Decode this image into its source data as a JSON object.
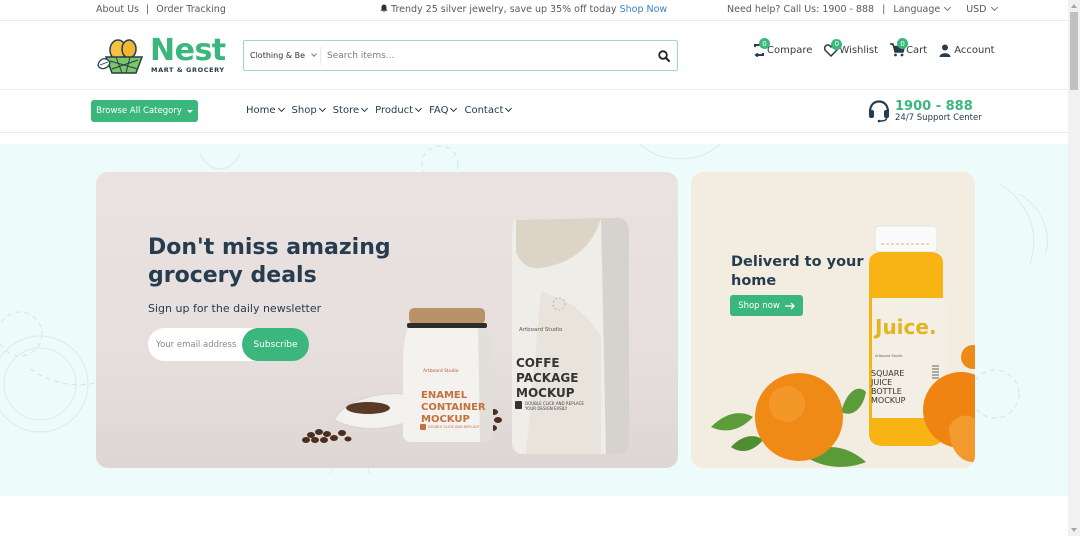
{
  "topbar": {
    "links": [
      "About Us",
      "Order Tracking"
    ],
    "separator": "|",
    "promo_text": "Trendy 25 silver jewelry, save up 35% off today",
    "promo_link": "Shop Now",
    "help_text": "Need help? Call Us: 1900 - 888",
    "language_label": "Language",
    "currency_label": "USD"
  },
  "header": {
    "logo_name": "Nest",
    "logo_tagline": "MART & GROCERY",
    "search": {
      "category_value": "Clothing & Be",
      "placeholder": "Search items...",
      "value": ""
    },
    "actions": [
      {
        "label": "Compare",
        "count": "0",
        "icon": "compare-icon"
      },
      {
        "label": "Wishlist",
        "count": "0",
        "icon": "heart-icon"
      },
      {
        "label": "Cart",
        "count": "0",
        "icon": "cart-icon"
      },
      {
        "label": "Account",
        "icon": "user-icon"
      }
    ]
  },
  "nav": {
    "browse_label": "Browse All Category",
    "items": [
      "Home",
      "Shop",
      "Store",
      "Product",
      "FAQ",
      "Contact"
    ],
    "support_number": "1900 - 888",
    "support_label": "24/7 Support Center"
  },
  "hero": {
    "main": {
      "headline": "Don't miss amazing grocery deals",
      "subheading": "Sign up for the daily newsletter",
      "email_placeholder": "Your email address",
      "subscribe_label": "Subscribe",
      "product_images": [
        {
          "brand": "Artboard Studio",
          "title": "ENAMEL CONTAINER MOCKUP",
          "note": "DOUBLE CLICK AND REPLACE YOUR DESIGN EASILY"
        },
        {
          "brand": "Artboard Studio",
          "title": "COFFE PACKAGE MOCKUP",
          "note": "DOUBLE CLICK AND REPLACE YOUR DESIGN EASILY"
        }
      ]
    },
    "side": {
      "headline": "Deliverd to your home",
      "button_label": "Shop now",
      "product_image": {
        "label": "Juice.",
        "brand": "Artboard Studio",
        "title": "SQUARE JUICE BOTTLE MOCKUP"
      }
    }
  },
  "colors": {
    "brand": "#3BB77E",
    "text": "#253D4E",
    "hero_bg": "#eefbfb",
    "link": "#3b82c8"
  }
}
